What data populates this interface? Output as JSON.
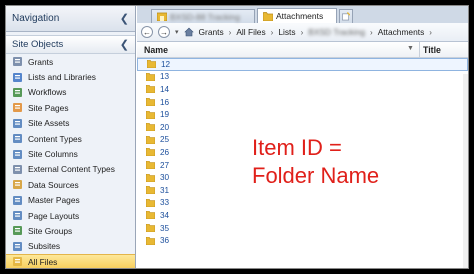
{
  "navigation": {
    "title": "Navigation",
    "collapse_glyph": "❮",
    "section_title": "Site Objects",
    "section_collapse_glyph": "❮",
    "items": [
      {
        "label": "Grants",
        "icon": "grants-icon",
        "color": "#6a7fa0"
      },
      {
        "label": "Lists and Libraries",
        "icon": "lists-libraries-icon",
        "color": "#3a72c4"
      },
      {
        "label": "Workflows",
        "icon": "workflows-icon",
        "color": "#3c8a3c"
      },
      {
        "label": "Site Pages",
        "icon": "site-pages-icon",
        "color": "#e08a2c"
      },
      {
        "label": "Site Assets",
        "icon": "site-assets-icon",
        "color": "#4a7ab8"
      },
      {
        "label": "Content Types",
        "icon": "content-types-icon",
        "color": "#4a7ab8"
      },
      {
        "label": "Site Columns",
        "icon": "site-columns-icon",
        "color": "#4a7ab8"
      },
      {
        "label": "External Content Types",
        "icon": "external-content-types-icon",
        "color": "#6a7fa0"
      },
      {
        "label": "Data Sources",
        "icon": "data-sources-icon",
        "color": "#d49a2a"
      },
      {
        "label": "Master Pages",
        "icon": "master-pages-icon",
        "color": "#4a7ab8"
      },
      {
        "label": "Page Layouts",
        "icon": "page-layouts-icon",
        "color": "#4a7ab8"
      },
      {
        "label": "Site Groups",
        "icon": "site-groups-icon",
        "color": "#3c8a3c"
      },
      {
        "label": "Subsites",
        "icon": "subsites-icon",
        "color": "#4a7ab8"
      },
      {
        "label": "All Files",
        "icon": "all-files-icon",
        "color": "#e2b23c",
        "selected": true
      }
    ]
  },
  "tabs": [
    {
      "label": "BXSD-88 Tracking",
      "obscured": true,
      "active": false,
      "icon": "home-folder-icon"
    },
    {
      "label": "Attachments",
      "obscured": false,
      "active": true,
      "icon": "folder-icon"
    }
  ],
  "new_tab_icon": "new-tab-icon",
  "breadcrumb": {
    "back_glyph": "←",
    "forward_glyph": "→",
    "dropdown_glyph": "▾",
    "separator": "›",
    "items": [
      {
        "label": "Grants",
        "obscured": false
      },
      {
        "label": "All Files",
        "obscured": false
      },
      {
        "label": "Lists",
        "obscured": false
      },
      {
        "label": "BXSD Tracking",
        "obscured": true
      },
      {
        "label": "Attachments",
        "obscured": false
      }
    ]
  },
  "columns": {
    "name": "Name",
    "title": "Title",
    "sort_glyph": "▼"
  },
  "folders": [
    "12",
    "13",
    "14",
    "16",
    "19",
    "20",
    "25",
    "26",
    "27",
    "30",
    "31",
    "33",
    "34",
    "35",
    "36"
  ],
  "selected_folder": "12",
  "annotation": {
    "line1": "Item ID =",
    "line2": "Folder Name",
    "color": "#e0201a"
  },
  "colors": {
    "folder": "#e8b833",
    "selection": "#f8cf5e",
    "link": "#1c4f9c"
  }
}
